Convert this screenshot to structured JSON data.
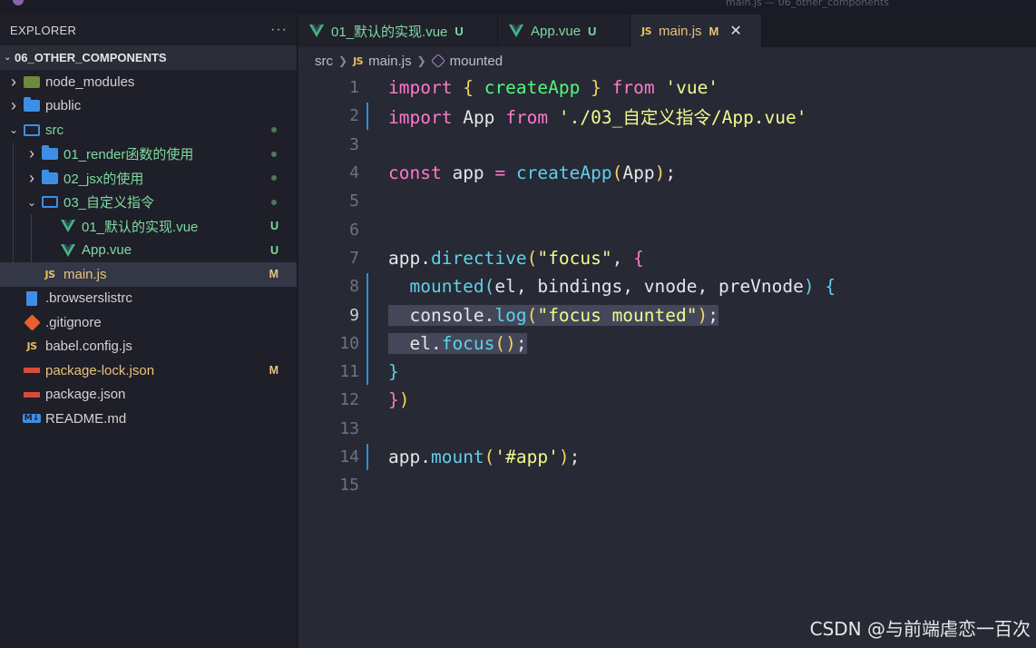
{
  "window": {
    "title": "main.js — 06_other_components"
  },
  "explorer": {
    "title": "EXPLORER",
    "more": "···",
    "project": "06_OTHER_COMPONENTS"
  },
  "tree": [
    {
      "label": "node_modules",
      "kind": "folder-nm",
      "depth": 0,
      "chev": "right"
    },
    {
      "label": "public",
      "kind": "folder",
      "depth": 0,
      "chev": "right"
    },
    {
      "label": "src",
      "kind": "folder-open",
      "depth": 0,
      "chev": "down",
      "status": "untracked",
      "dot": true
    },
    {
      "label": "01_render函数的使用",
      "kind": "folder",
      "depth": 1,
      "chev": "right",
      "status": "untracked",
      "dot": true
    },
    {
      "label": "02_jsx的使用",
      "kind": "folder",
      "depth": 1,
      "chev": "right",
      "status": "untracked",
      "dot": true
    },
    {
      "label": "03_自定义指令",
      "kind": "folder-open",
      "depth": 1,
      "chev": "down",
      "status": "untracked",
      "dot": true
    },
    {
      "label": "01_默认的实现.vue",
      "kind": "vue",
      "depth": 2,
      "status": "untracked",
      "badge": "U"
    },
    {
      "label": "App.vue",
      "kind": "vue",
      "depth": 2,
      "status": "untracked",
      "badge": "U"
    },
    {
      "label": "main.js",
      "kind": "js",
      "depth": 1,
      "status": "modified",
      "badge": "M",
      "selected": true
    },
    {
      "label": ".browserslistrc",
      "kind": "file",
      "depth": 0
    },
    {
      "label": ".gitignore",
      "kind": "git",
      "depth": 0
    },
    {
      "label": "babel.config.js",
      "kind": "js",
      "depth": 0
    },
    {
      "label": "package-lock.json",
      "kind": "npm",
      "depth": 0,
      "status": "modified",
      "badge": "M"
    },
    {
      "label": "package.json",
      "kind": "npm",
      "depth": 0
    },
    {
      "label": "README.md",
      "kind": "md",
      "depth": 0
    }
  ],
  "tabs": [
    {
      "label": "01_默认的实现.vue",
      "kind": "vue",
      "status": "U",
      "state": "untracked"
    },
    {
      "label": "App.vue",
      "kind": "vue",
      "status": "U",
      "state": "untracked"
    },
    {
      "label": "main.js",
      "kind": "js",
      "status": "M",
      "state": "modified",
      "active": true,
      "close": "✕"
    }
  ],
  "breadcrumb": {
    "parts": [
      "src",
      "main.js",
      "mounted"
    ]
  },
  "editor": {
    "current_line": 9,
    "lines": [
      [
        [
          "kw",
          "import"
        ],
        [
          "plain",
          " "
        ],
        [
          "br1",
          "{"
        ],
        [
          "plain",
          " "
        ],
        [
          "fn",
          "createApp"
        ],
        [
          "plain",
          " "
        ],
        [
          "br1",
          "}"
        ],
        [
          "plain",
          " "
        ],
        [
          "kw",
          "from"
        ],
        [
          "plain",
          " "
        ],
        [
          "str",
          "'vue'"
        ]
      ],
      [
        [
          "kw",
          "import"
        ],
        [
          "plain",
          " "
        ],
        [
          "var",
          "App"
        ],
        [
          "plain",
          " "
        ],
        [
          "kw",
          "from"
        ],
        [
          "plain",
          " "
        ],
        [
          "str",
          "'./03_自定义指令/App.vue'"
        ]
      ],
      [],
      [
        [
          "kw",
          "const"
        ],
        [
          "plain",
          " "
        ],
        [
          "var",
          "app"
        ],
        [
          "plain",
          " "
        ],
        [
          "kw",
          "="
        ],
        [
          "plain",
          " "
        ],
        [
          "fnb",
          "createApp"
        ],
        [
          "br1",
          "("
        ],
        [
          "plain",
          "App"
        ],
        [
          "br1",
          ")"
        ],
        [
          "plain",
          ";"
        ]
      ],
      [],
      [],
      [
        [
          "plain",
          "app."
        ],
        [
          "fnb",
          "directive"
        ],
        [
          "br1",
          "("
        ],
        [
          "str",
          "\"focus\""
        ],
        [
          "plain",
          ", "
        ],
        [
          "br2",
          "{"
        ]
      ],
      [
        [
          "plain",
          "  "
        ],
        [
          "fnb",
          "mounted"
        ],
        [
          "br3",
          "("
        ],
        [
          "plain",
          "el, bindings, vnode, preVnode"
        ],
        [
          "br3",
          ")"
        ],
        [
          "plain",
          " "
        ],
        [
          "br3",
          "{"
        ]
      ],
      [
        [
          "plain",
          "  console."
        ],
        [
          "fnb",
          "log"
        ],
        [
          "br1",
          "("
        ],
        [
          "str",
          "\"focus mounted\""
        ],
        [
          "br1",
          ")"
        ],
        [
          "plain",
          ";"
        ]
      ],
      [
        [
          "plain",
          "  el."
        ],
        [
          "fnb",
          "focus"
        ],
        [
          "br1",
          "()"
        ],
        [
          "plain",
          ";"
        ]
      ],
      [
        [
          "br3",
          "}"
        ]
      ],
      [
        [
          "br2",
          "}"
        ],
        [
          "br1",
          ")"
        ]
      ],
      [],
      [
        [
          "plain",
          "app."
        ],
        [
          "fnb",
          "mount"
        ],
        [
          "br1",
          "("
        ],
        [
          "str",
          "'#app'"
        ],
        [
          "br1",
          ")"
        ],
        [
          "plain",
          ";"
        ]
      ],
      []
    ]
  },
  "watermark": "CSDN @与前端虐恋一百次"
}
